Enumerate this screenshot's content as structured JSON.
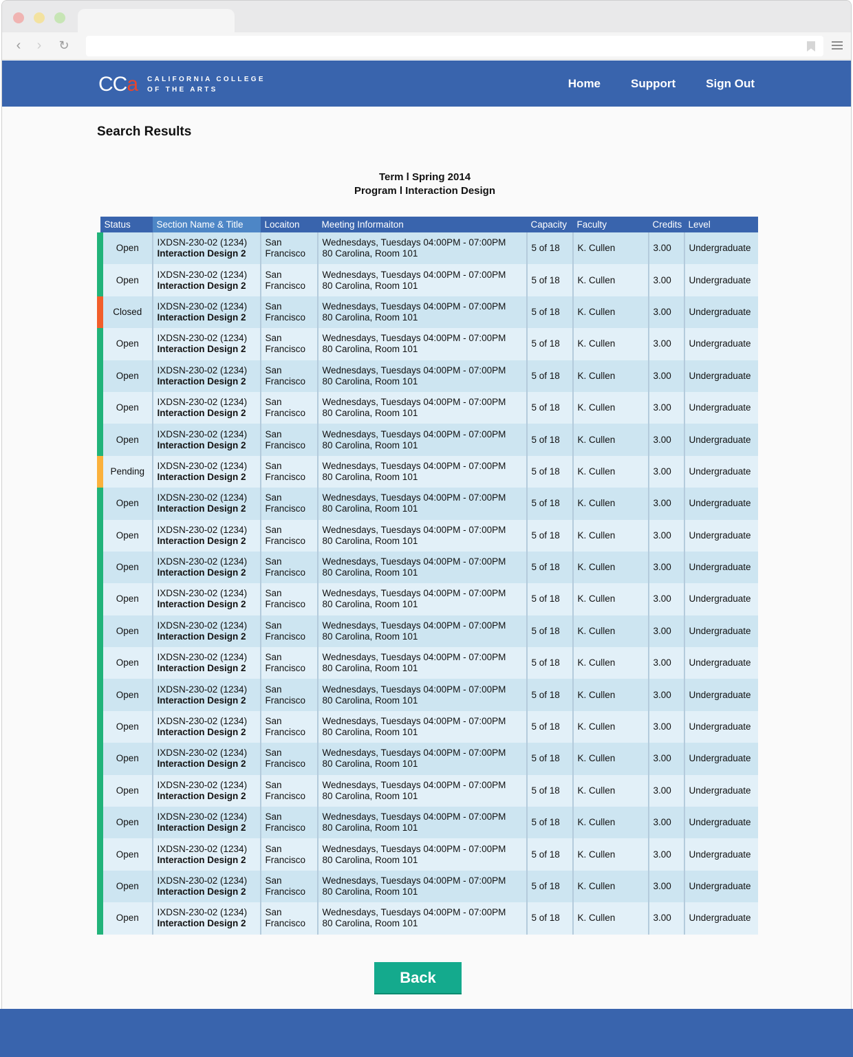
{
  "chrome": {
    "dot_colors": [
      "#f0b4b2",
      "#f3e2a0",
      "#c7e5b5"
    ],
    "back_icon": "‹",
    "forward_icon": "›",
    "reload_icon": "↻"
  },
  "header": {
    "logo_mark": "CC",
    "logo_mark_accent": "a",
    "logo_line1": "CALIFORNIA COLLEGE",
    "logo_line2": "OF THE ARTS",
    "nav": [
      "Home",
      "Support",
      "Sign Out"
    ],
    "color": "#3964ad"
  },
  "page": {
    "title": "Search Results",
    "term": "Term l Spring 2014",
    "program": "Program l Interaction Design"
  },
  "table": {
    "columns": [
      "Status",
      "Section Name & Title",
      "Locaiton",
      "Meeting Informaiton",
      "Capacity",
      "Faculty",
      "Credits",
      "Level"
    ],
    "status_colors": {
      "Open": "#21b37a",
      "Closed": "#f25e2a",
      "Pending": "#fbb13c"
    },
    "rows": [
      {
        "status": "Open",
        "section": "IXDSN-230-02 (1234)",
        "title": "Interaction Design 2",
        "location": "San Francisco",
        "meeting_time": "Wednesdays, Tuesdays 04:00PM - 07:00PM",
        "meeting_room": "80 Carolina, Room 101",
        "capacity": "5 of 18",
        "faculty": "K. Cullen",
        "credits": "3.00",
        "level": "Undergraduate"
      },
      {
        "status": "Open",
        "section": "IXDSN-230-02 (1234)",
        "title": "Interaction Design 2",
        "location": "San Francisco",
        "meeting_time": "Wednesdays, Tuesdays 04:00PM - 07:00PM",
        "meeting_room": "80 Carolina, Room 101",
        "capacity": "5 of 18",
        "faculty": "K. Cullen",
        "credits": "3.00",
        "level": "Undergraduate"
      },
      {
        "status": "Closed",
        "section": "IXDSN-230-02 (1234)",
        "title": "Interaction Design 2",
        "location": "San Francisco",
        "meeting_time": "Wednesdays, Tuesdays 04:00PM - 07:00PM",
        "meeting_room": "80 Carolina, Room 101",
        "capacity": "5 of 18",
        "faculty": "K. Cullen",
        "credits": "3.00",
        "level": "Undergraduate"
      },
      {
        "status": "Open",
        "section": "IXDSN-230-02 (1234)",
        "title": "Interaction Design 2",
        "location": "San Francisco",
        "meeting_time": "Wednesdays, Tuesdays 04:00PM - 07:00PM",
        "meeting_room": "80 Carolina, Room 101",
        "capacity": "5 of 18",
        "faculty": "K. Cullen",
        "credits": "3.00",
        "level": "Undergraduate"
      },
      {
        "status": "Open",
        "section": "IXDSN-230-02 (1234)",
        "title": "Interaction Design 2",
        "location": "San Francisco",
        "meeting_time": "Wednesdays, Tuesdays 04:00PM - 07:00PM",
        "meeting_room": "80 Carolina, Room 101",
        "capacity": "5 of 18",
        "faculty": "K. Cullen",
        "credits": "3.00",
        "level": "Undergraduate"
      },
      {
        "status": "Open",
        "section": "IXDSN-230-02 (1234)",
        "title": "Interaction Design 2",
        "location": "San Francisco",
        "meeting_time": "Wednesdays, Tuesdays 04:00PM - 07:00PM",
        "meeting_room": "80 Carolina, Room 101",
        "capacity": "5 of 18",
        "faculty": "K. Cullen",
        "credits": "3.00",
        "level": "Undergraduate"
      },
      {
        "status": "Open",
        "section": "IXDSN-230-02 (1234)",
        "title": "Interaction Design 2",
        "location": "San Francisco",
        "meeting_time": "Wednesdays, Tuesdays 04:00PM - 07:00PM",
        "meeting_room": "80 Carolina, Room 101",
        "capacity": "5 of 18",
        "faculty": "K. Cullen",
        "credits": "3.00",
        "level": "Undergraduate"
      },
      {
        "status": "Pending",
        "section": "IXDSN-230-02 (1234)",
        "title": "Interaction Design 2",
        "location": "San Francisco",
        "meeting_time": "Wednesdays, Tuesdays 04:00PM - 07:00PM",
        "meeting_room": "80 Carolina, Room 101",
        "capacity": "5 of 18",
        "faculty": "K. Cullen",
        "credits": "3.00",
        "level": "Undergraduate"
      },
      {
        "status": "Open",
        "section": "IXDSN-230-02 (1234)",
        "title": "Interaction Design 2",
        "location": "San Francisco",
        "meeting_time": "Wednesdays, Tuesdays 04:00PM - 07:00PM",
        "meeting_room": "80 Carolina, Room 101",
        "capacity": "5 of 18",
        "faculty": "K. Cullen",
        "credits": "3.00",
        "level": "Undergraduate"
      },
      {
        "status": "Open",
        "section": "IXDSN-230-02 (1234)",
        "title": "Interaction Design 2",
        "location": "San Francisco",
        "meeting_time": "Wednesdays, Tuesdays 04:00PM - 07:00PM",
        "meeting_room": "80 Carolina, Room 101",
        "capacity": "5 of 18",
        "faculty": "K. Cullen",
        "credits": "3.00",
        "level": "Undergraduate"
      },
      {
        "status": "Open",
        "section": "IXDSN-230-02 (1234)",
        "title": "Interaction Design 2",
        "location": "San Francisco",
        "meeting_time": "Wednesdays, Tuesdays 04:00PM - 07:00PM",
        "meeting_room": "80 Carolina, Room 101",
        "capacity": "5 of 18",
        "faculty": "K. Cullen",
        "credits": "3.00",
        "level": "Undergraduate"
      },
      {
        "status": "Open",
        "section": "IXDSN-230-02 (1234)",
        "title": "Interaction Design 2",
        "location": "San Francisco",
        "meeting_time": "Wednesdays, Tuesdays 04:00PM - 07:00PM",
        "meeting_room": "80 Carolina, Room 101",
        "capacity": "5 of 18",
        "faculty": "K. Cullen",
        "credits": "3.00",
        "level": "Undergraduate"
      },
      {
        "status": "Open",
        "section": "IXDSN-230-02 (1234)",
        "title": "Interaction Design 2",
        "location": "San Francisco",
        "meeting_time": "Wednesdays, Tuesdays 04:00PM - 07:00PM",
        "meeting_room": "80 Carolina, Room 101",
        "capacity": "5 of 18",
        "faculty": "K. Cullen",
        "credits": "3.00",
        "level": "Undergraduate"
      },
      {
        "status": "Open",
        "section": "IXDSN-230-02 (1234)",
        "title": "Interaction Design 2",
        "location": "San Francisco",
        "meeting_time": "Wednesdays, Tuesdays 04:00PM - 07:00PM",
        "meeting_room": "80 Carolina, Room 101",
        "capacity": "5 of 18",
        "faculty": "K. Cullen",
        "credits": "3.00",
        "level": "Undergraduate"
      },
      {
        "status": "Open",
        "section": "IXDSN-230-02 (1234)",
        "title": "Interaction Design 2",
        "location": "San Francisco",
        "meeting_time": "Wednesdays, Tuesdays 04:00PM - 07:00PM",
        "meeting_room": "80 Carolina, Room 101",
        "capacity": "5 of 18",
        "faculty": "K. Cullen",
        "credits": "3.00",
        "level": "Undergraduate"
      },
      {
        "status": "Open",
        "section": "IXDSN-230-02 (1234)",
        "title": "Interaction Design 2",
        "location": "San Francisco",
        "meeting_time": "Wednesdays, Tuesdays 04:00PM - 07:00PM",
        "meeting_room": "80 Carolina, Room 101",
        "capacity": "5 of 18",
        "faculty": "K. Cullen",
        "credits": "3.00",
        "level": "Undergraduate"
      },
      {
        "status": "Open",
        "section": "IXDSN-230-02 (1234)",
        "title": "Interaction Design 2",
        "location": "San Francisco",
        "meeting_time": "Wednesdays, Tuesdays 04:00PM - 07:00PM",
        "meeting_room": "80 Carolina, Room 101",
        "capacity": "5 of 18",
        "faculty": "K. Cullen",
        "credits": "3.00",
        "level": "Undergraduate"
      },
      {
        "status": "Open",
        "section": "IXDSN-230-02 (1234)",
        "title": "Interaction Design 2",
        "location": "San Francisco",
        "meeting_time": "Wednesdays, Tuesdays 04:00PM - 07:00PM",
        "meeting_room": "80 Carolina, Room 101",
        "capacity": "5 of 18",
        "faculty": "K. Cullen",
        "credits": "3.00",
        "level": "Undergraduate"
      },
      {
        "status": "Open",
        "section": "IXDSN-230-02 (1234)",
        "title": "Interaction Design 2",
        "location": "San Francisco",
        "meeting_time": "Wednesdays, Tuesdays 04:00PM - 07:00PM",
        "meeting_room": "80 Carolina, Room 101",
        "capacity": "5 of 18",
        "faculty": "K. Cullen",
        "credits": "3.00",
        "level": "Undergraduate"
      },
      {
        "status": "Open",
        "section": "IXDSN-230-02 (1234)",
        "title": "Interaction Design 2",
        "location": "San Francisco",
        "meeting_time": "Wednesdays, Tuesdays 04:00PM - 07:00PM",
        "meeting_room": "80 Carolina, Room 101",
        "capacity": "5 of 18",
        "faculty": "K. Cullen",
        "credits": "3.00",
        "level": "Undergraduate"
      },
      {
        "status": "Open",
        "section": "IXDSN-230-02 (1234)",
        "title": "Interaction Design 2",
        "location": "San Francisco",
        "meeting_time": "Wednesdays, Tuesdays 04:00PM - 07:00PM",
        "meeting_room": "80 Carolina, Room 101",
        "capacity": "5 of 18",
        "faculty": "K. Cullen",
        "credits": "3.00",
        "level": "Undergraduate"
      },
      {
        "status": "Open",
        "section": "IXDSN-230-02 (1234)",
        "title": "Interaction Design 2",
        "location": "San Francisco",
        "meeting_time": "Wednesdays, Tuesdays 04:00PM - 07:00PM",
        "meeting_room": "80 Carolina, Room 101",
        "capacity": "5 of 18",
        "faculty": "K. Cullen",
        "credits": "3.00",
        "level": "Undergraduate"
      }
    ]
  },
  "actions": {
    "back_label": "Back"
  }
}
